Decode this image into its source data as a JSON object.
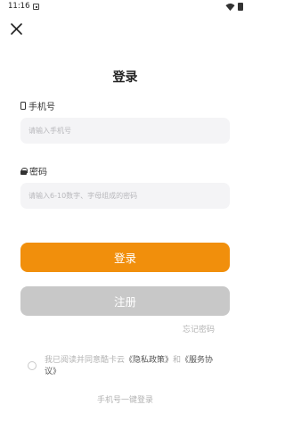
{
  "status_bar": {
    "time": "11:16"
  },
  "page": {
    "title": "登录"
  },
  "phone": {
    "label": "手机号",
    "placeholder": "请输入手机号",
    "value": ""
  },
  "password": {
    "label": "密码",
    "placeholder": "请输入6-10数字、字母组成的密码",
    "value": ""
  },
  "buttons": {
    "login": "登录",
    "register": "注册",
    "forgot": "忘记密码"
  },
  "agreement": {
    "prefix": "我已阅读并同意酷卡云",
    "privacy": "《隐私政策》",
    "connector": "和",
    "service": "《服务协议》",
    "checked": false
  },
  "quick_login": "手机号一键登录",
  "colors": {
    "primary": "#f18f0c",
    "disabled": "#c8c8c8",
    "input_bg": "#f4f4f6",
    "muted_text": "#b3b3b3"
  },
  "icons": {
    "close": "close-icon",
    "phone": "phone-icon",
    "lock": "lock-icon",
    "wifi": "wifi-icon",
    "battery": "battery-icon",
    "notification": "notification-icon"
  }
}
